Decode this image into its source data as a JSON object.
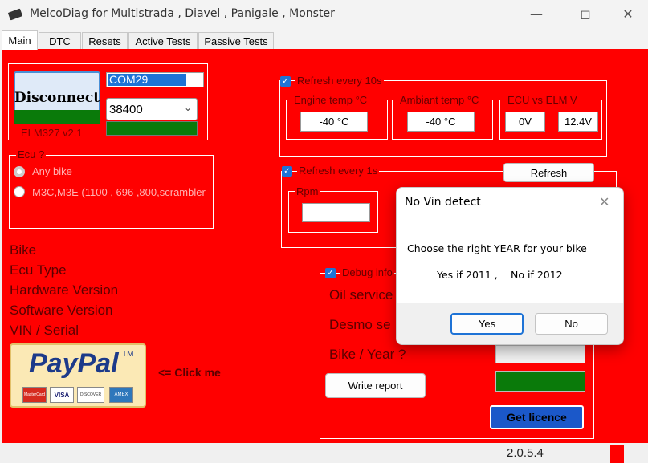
{
  "window": {
    "title": "MelcoDiag for Multistrada , Diavel , Panigale , Monster"
  },
  "tabs": [
    {
      "label": "Main"
    },
    {
      "label": "DTC"
    },
    {
      "label": "Resets"
    },
    {
      "label": "Active Tests"
    },
    {
      "label": "Passive Tests"
    }
  ],
  "connection": {
    "disconnect_label": "Disconnect",
    "port_value": "COM29",
    "baud_value": "38400",
    "elm_version": "ELM327 v2.1"
  },
  "ecu_group": {
    "legend": "Ecu ?",
    "options": [
      {
        "label": "Any bike"
      },
      {
        "label": "M3C,M3E (1100 , 696 ,800,scrambler"
      }
    ]
  },
  "refresh10": {
    "label": "Refresh every 10s",
    "engine_temp_legend": "Engine temp °C",
    "engine_temp_value": "-40 °C",
    "ambient_temp_legend": "Ambiant temp °C",
    "ambient_temp_value": "-40 °C",
    "ecu_vs_elm_legend": "ECU vs ELM V",
    "ecu_voltage": "0V",
    "elm_voltage": "12.4V"
  },
  "refresh1": {
    "label": "Refresh every 1s",
    "rpm_legend": "Rpm",
    "refresh_button": "Refresh"
  },
  "info_labels": {
    "bike": "Bike",
    "ecu_type": "Ecu Type",
    "hardware_version": "Hardware Version",
    "software_version": "Software Version",
    "vin_serial": "VIN / Serial"
  },
  "paypal": {
    "logo_text": "PayPal",
    "click_me": "<= Click me",
    "cards": [
      "MasterCard",
      "VISA",
      "DISCOVER",
      "AMEX"
    ]
  },
  "debug": {
    "label": "Debug info",
    "oil_service": "Oil service",
    "desmo_service": "Desmo se",
    "bike_year": "Bike / Year ?",
    "write_report": "Write report",
    "get_licence": "Get licence"
  },
  "status": {
    "version": "2.0.5.4"
  },
  "dialog": {
    "title": "No Vin detect",
    "message": "Choose the right YEAR for your bike",
    "yes_hint": "Yes if 2011 ,",
    "no_hint": "No if 2012",
    "yes_button": "Yes",
    "no_button": "No"
  },
  "colors": {
    "panel": "#ff0000",
    "accent_green": "#0a7a0a",
    "selection_blue": "#1e73d6"
  }
}
